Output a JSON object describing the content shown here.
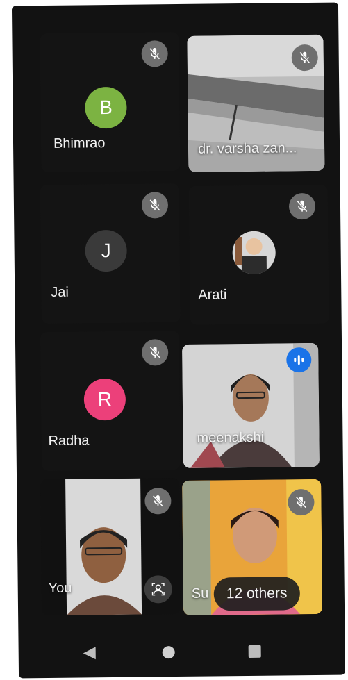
{
  "participants": {
    "bhimrao": {
      "name": "Bhimrao",
      "initial": "B",
      "avatar_color": "#7cb342"
    },
    "varsha": {
      "name": "dr. varsha zan..."
    },
    "jai": {
      "name": "Jai",
      "initial": "J",
      "avatar_color": "#3a3a3a"
    },
    "arati": {
      "name": "Arati"
    },
    "radha": {
      "name": "Radha",
      "initial": "R",
      "avatar_color": "#ec407a"
    },
    "meenakshi": {
      "name": "meenakshi"
    },
    "you": {
      "name": "You"
    },
    "su": {
      "name": "Su"
    }
  },
  "others_chip": {
    "label": "12 others"
  },
  "icons": {
    "muted": "mic-off-icon",
    "speaking": "audio-level-icon",
    "self_view": "person-frame-icon",
    "back": "back-triangle-icon",
    "home": "home-circle-icon",
    "recents": "recents-square-icon"
  },
  "colors": {
    "speaking_blue": "#1a73e8",
    "background": "#121212"
  }
}
